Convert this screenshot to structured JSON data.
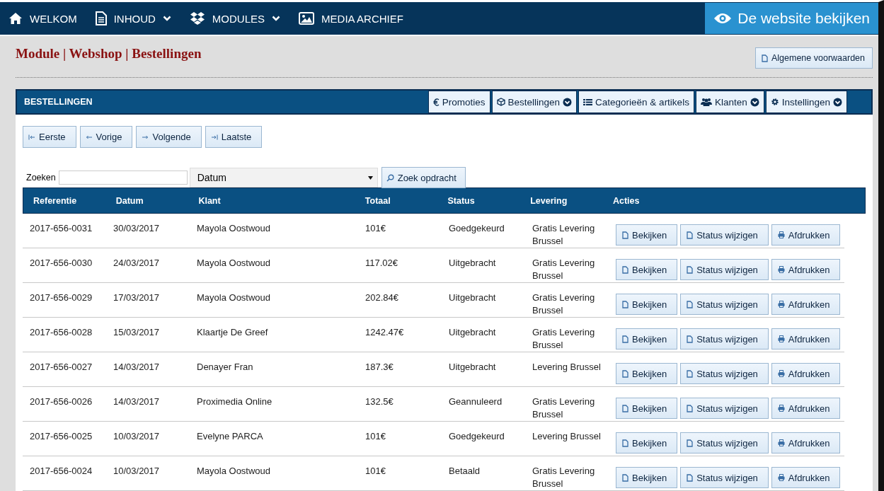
{
  "nav": {
    "items": [
      {
        "kind": "home",
        "label": "WELKOM",
        "dropdown": false
      },
      {
        "kind": "document",
        "label": "INHOUD",
        "dropdown": true
      },
      {
        "kind": "boxes",
        "label": "MODULES",
        "dropdown": true
      },
      {
        "kind": "image",
        "label": "MEDIA ARCHIEF",
        "dropdown": false
      }
    ],
    "view_site": "De website bekijken"
  },
  "breadcrumb": "Module | Webshop | Bestellingen",
  "terms_button": "Algemene voorwaarden",
  "panel": {
    "title": "BESTELLINGEN",
    "tabs": [
      {
        "kind": "euro",
        "label": "Promoties",
        "dropdown": false
      },
      {
        "kind": "cube",
        "label": "Bestellingen",
        "dropdown": true
      },
      {
        "kind": "list",
        "label": "Categorieën & artikels",
        "dropdown": false
      },
      {
        "kind": "users",
        "label": "Klanten",
        "dropdown": true
      },
      {
        "kind": "gear",
        "label": "Instellingen",
        "dropdown": true
      }
    ]
  },
  "pager": [
    {
      "kind": "first",
      "label": "Eerste"
    },
    {
      "kind": "prev",
      "label": "Vorige"
    },
    {
      "kind": "next",
      "label": "Volgende"
    },
    {
      "kind": "last",
      "label": "Laatste"
    }
  ],
  "search": {
    "label": "Zoeken",
    "select_value": "Datum",
    "button": "Zoek opdracht"
  },
  "table": {
    "columns": [
      "Referentie",
      "Datum",
      "Klant",
      "Totaal",
      "Status",
      "Levering",
      "Acties"
    ],
    "rows": [
      {
        "cells": [
          "2017-656-0031",
          "30/03/2017",
          "Mayola Oostwoud",
          "101€",
          "Goedgekeurd",
          "Gratis Levering Brussel"
        ],
        "actions": [
          {
            "kind": "view",
            "label": "Bekijken"
          },
          {
            "kind": "status",
            "label": "Status wijzigen"
          },
          {
            "kind": "print",
            "label": "Afdrukken"
          }
        ]
      },
      {
        "cells": [
          "2017-656-0030",
          "24/03/2017",
          "Mayola Oostwoud",
          "117.02€",
          "Uitgebracht",
          "Gratis Levering Brussel"
        ],
        "actions": [
          {
            "kind": "view",
            "label": "Bekijken"
          },
          {
            "kind": "status",
            "label": "Status wijzigen"
          },
          {
            "kind": "print",
            "label": "Afdrukken"
          }
        ]
      },
      {
        "cells": [
          "2017-656-0029",
          "17/03/2017",
          "Mayola Oostwoud",
          "202.84€",
          "Uitgebracht",
          "Gratis Levering Brussel"
        ],
        "actions": [
          {
            "kind": "view",
            "label": "Bekijken"
          },
          {
            "kind": "status",
            "label": "Status wijzigen"
          },
          {
            "kind": "print",
            "label": "Afdrukken"
          }
        ]
      },
      {
        "cells": [
          "2017-656-0028",
          "15/03/2017",
          "Klaartje De Greef",
          "1242.47€",
          "Uitgebracht",
          "Gratis Levering Brussel"
        ],
        "actions": [
          {
            "kind": "view",
            "label": "Bekijken"
          },
          {
            "kind": "status",
            "label": "Status wijzigen"
          },
          {
            "kind": "print",
            "label": "Afdrukken"
          }
        ]
      },
      {
        "cells": [
          "2017-656-0027",
          "14/03/2017",
          "Denayer Fran",
          "187.3€",
          "Uitgebracht",
          "Levering Brussel"
        ],
        "actions": [
          {
            "kind": "view",
            "label": "Bekijken"
          },
          {
            "kind": "status",
            "label": "Status wijzigen"
          },
          {
            "kind": "print",
            "label": "Afdrukken"
          }
        ]
      },
      {
        "cells": [
          "2017-656-0026",
          "14/03/2017",
          "Proximedia Online",
          "132.5€",
          "Geannuleerd",
          "Gratis Levering Brussel"
        ],
        "actions": [
          {
            "kind": "view",
            "label": "Bekijken"
          },
          {
            "kind": "status",
            "label": "Status wijzigen"
          },
          {
            "kind": "print",
            "label": "Afdrukken"
          }
        ]
      },
      {
        "cells": [
          "2017-656-0025",
          "10/03/2017",
          "Evelyne PARCA",
          "101€",
          "Goedgekeurd",
          "Levering Brussel"
        ],
        "actions": [
          {
            "kind": "view",
            "label": "Bekijken"
          },
          {
            "kind": "status",
            "label": "Status wijzigen"
          },
          {
            "kind": "print",
            "label": "Afdrukken"
          }
        ]
      },
      {
        "cells": [
          "2017-656-0024",
          "10/03/2017",
          "Mayola Oostwoud",
          "101€",
          "Betaald",
          "Gratis Levering Brussel"
        ],
        "actions": [
          {
            "kind": "view",
            "label": "Bekijken"
          },
          {
            "kind": "status",
            "label": "Status wijzigen"
          },
          {
            "kind": "print",
            "label": "Afdrukken"
          }
        ]
      }
    ]
  }
}
